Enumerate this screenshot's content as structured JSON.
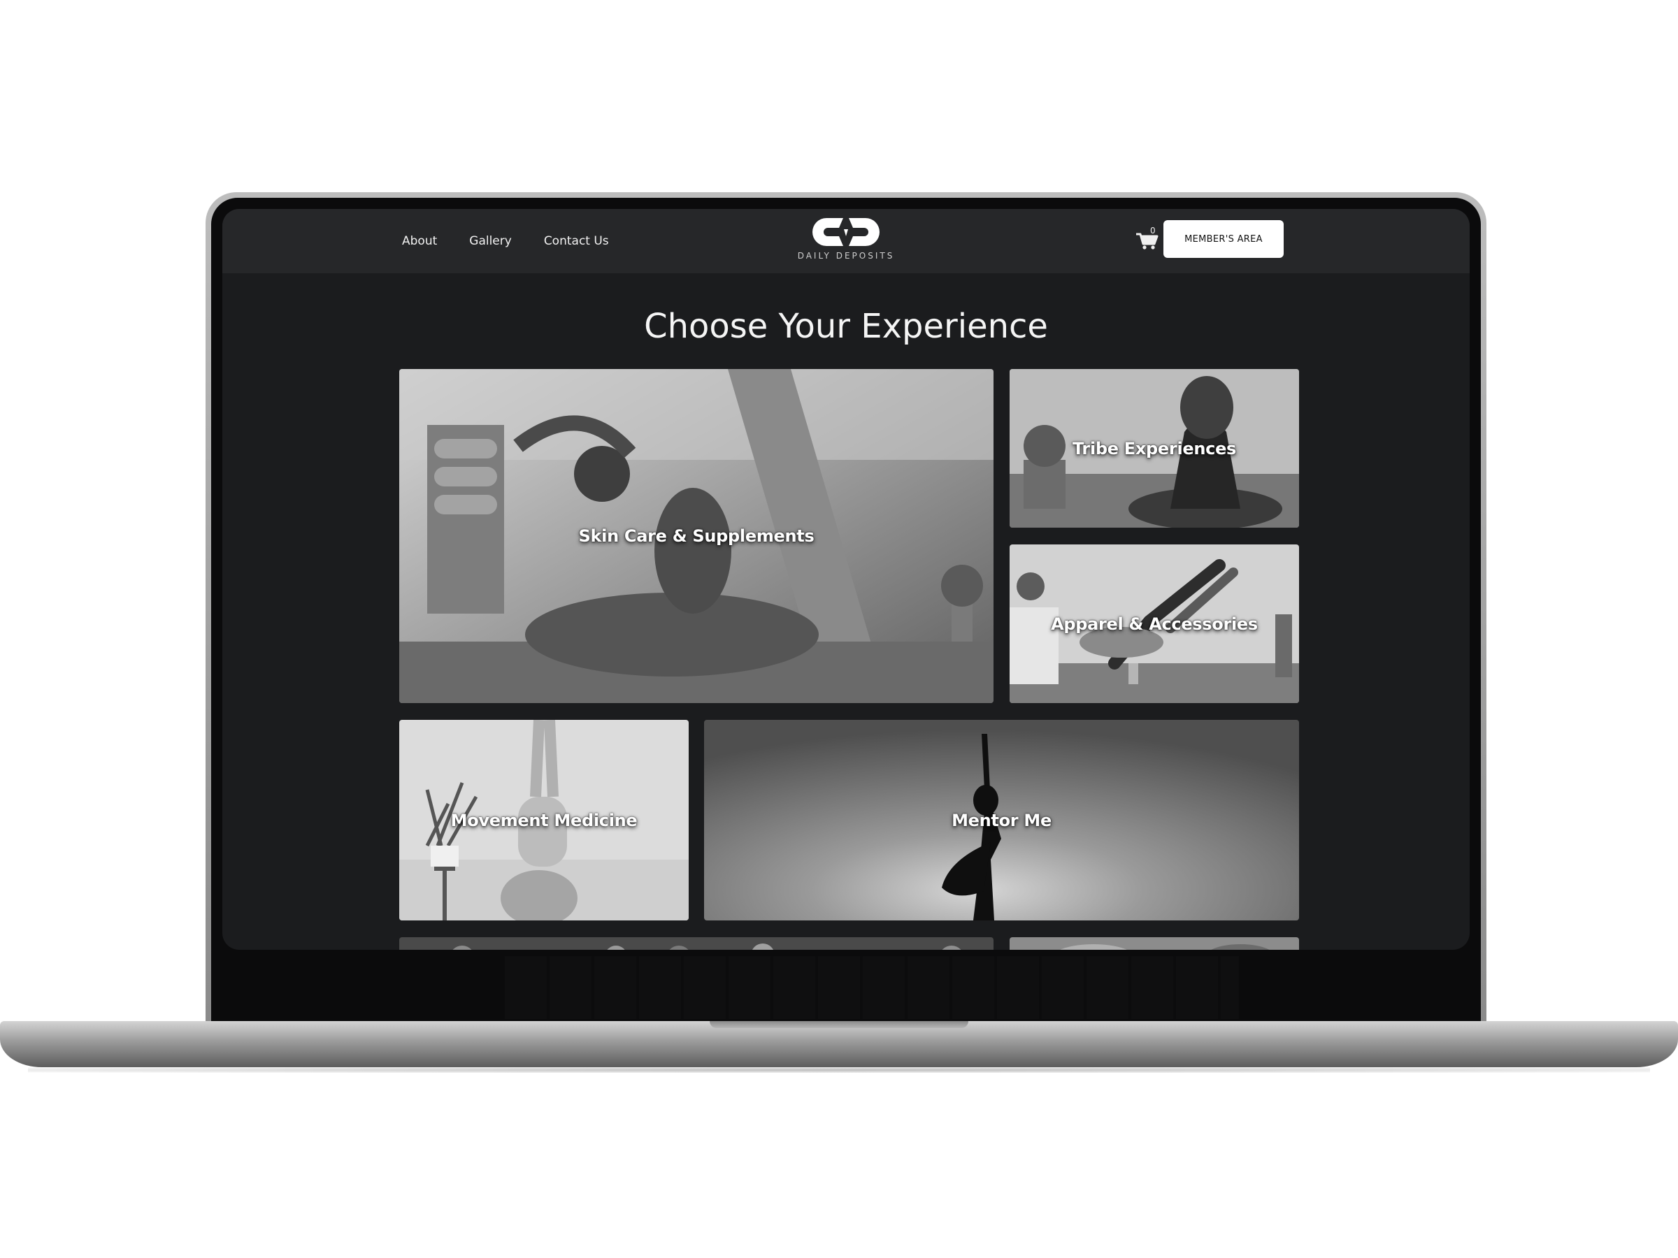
{
  "nav": {
    "items": [
      {
        "label": "About"
      },
      {
        "label": "Gallery"
      },
      {
        "label": "Contact Us"
      }
    ]
  },
  "logo": {
    "text": "DAILY DEPOSITS"
  },
  "cart": {
    "count": "0",
    "icon": "cart-icon"
  },
  "member_button": {
    "label": "MEMBER'S AREA"
  },
  "main": {
    "title": "Choose Your Experience",
    "tiles": [
      {
        "label": "Skin Care & Supplements"
      },
      {
        "label": "Tribe Experiences"
      },
      {
        "label": "Apparel & Accessories"
      },
      {
        "label": "Movement Medicine"
      },
      {
        "label": "Mentor Me"
      }
    ]
  },
  "colors": {
    "page_bg": "#1b1c1e",
    "header_bg": "#262729",
    "button_bg": "#ffffff",
    "text": "#ffffff"
  }
}
